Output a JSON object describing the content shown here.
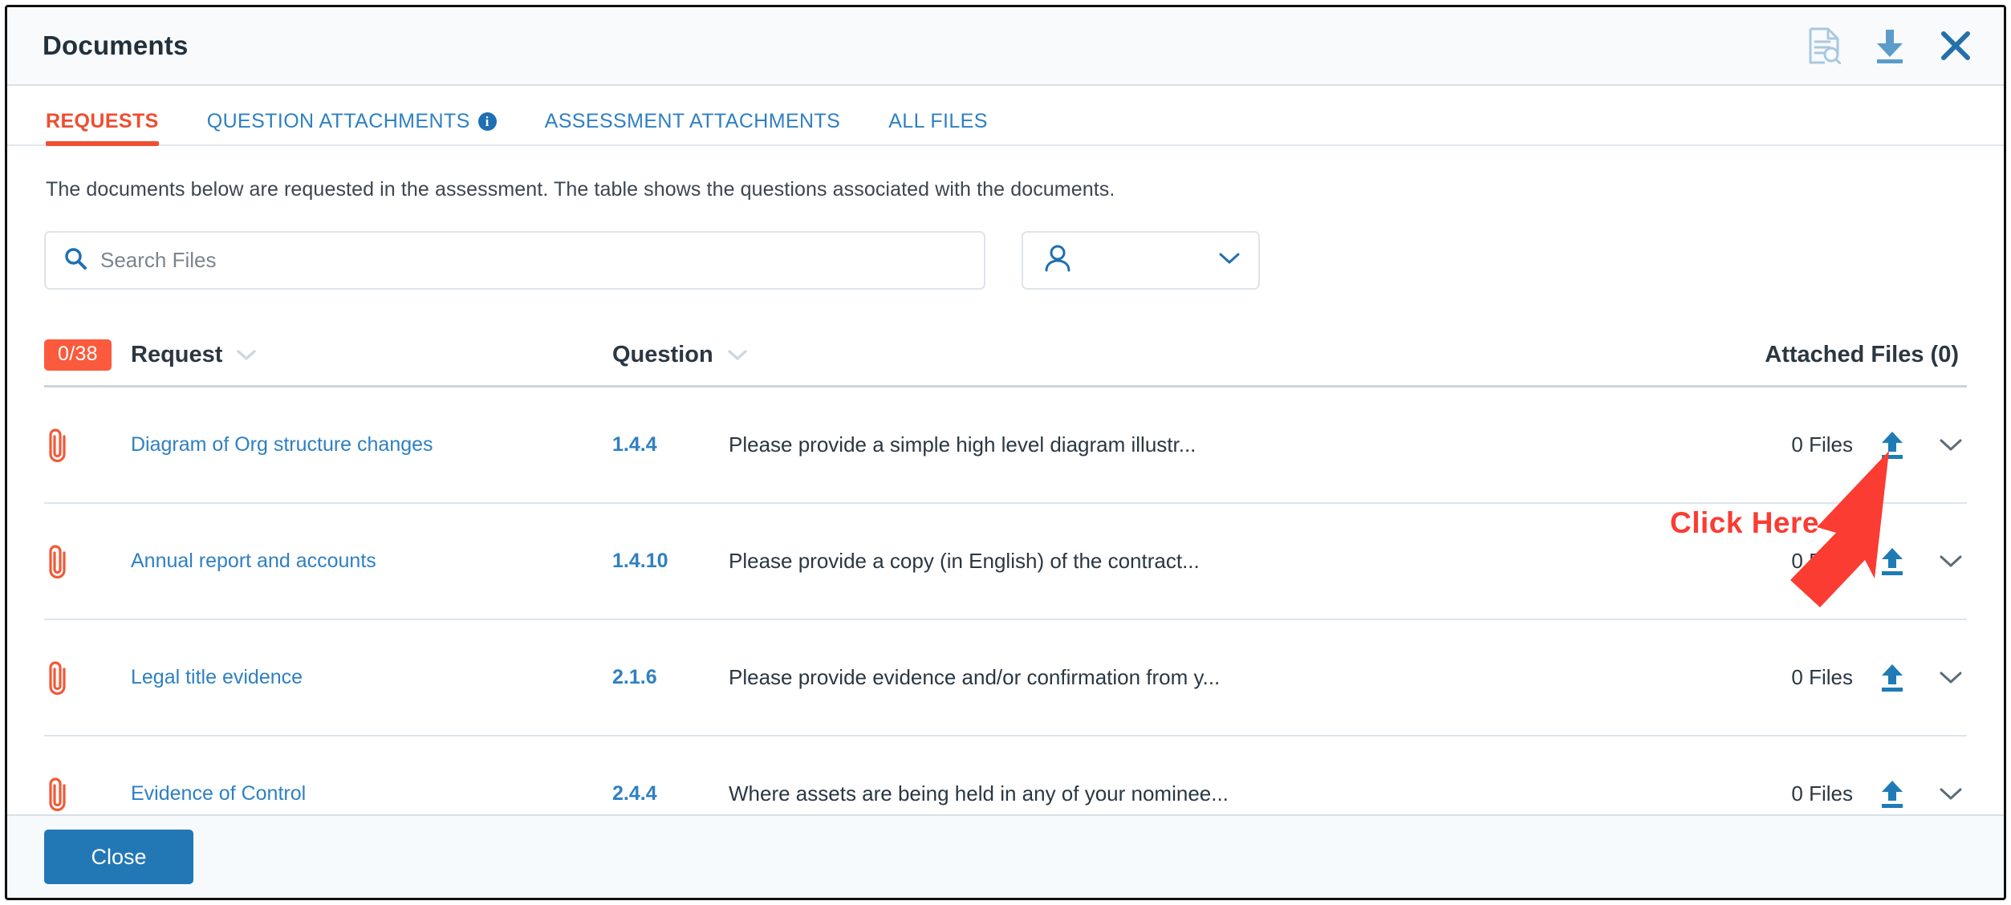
{
  "window": {
    "title": "Documents",
    "icons": [
      {
        "name": "document-search-icon"
      },
      {
        "name": "download-icon"
      },
      {
        "name": "close-icon"
      }
    ]
  },
  "tabs": [
    {
      "label": "REQUESTS",
      "active": true,
      "has_info": false
    },
    {
      "label": "QUESTION ATTACHMENTS",
      "active": false,
      "has_info": true,
      "info": "i"
    },
    {
      "label": "ASSESSMENT ATTACHMENTS",
      "active": false,
      "has_info": false
    },
    {
      "label": "ALL FILES",
      "active": false,
      "has_info": false
    }
  ],
  "description": "The documents below are requested in the assessment. The table shows the questions associated with the documents.",
  "search": {
    "placeholder": "Search Files",
    "value": ""
  },
  "person_filter": {
    "value": ""
  },
  "table": {
    "count_badge": "0/38",
    "headers": {
      "request": "Request",
      "question": "Question",
      "attached_files": "Attached Files (0)"
    },
    "rows": [
      {
        "request": "Diagram of Org structure changes",
        "question_number": "1.4.4",
        "question_text": "Please provide a simple high level diagram illustr...",
        "files": "0 Files"
      },
      {
        "request": "Annual report and accounts",
        "question_number": "1.4.10",
        "question_text": "Please provide a copy (in English) of the contract...",
        "files": "0 Files"
      },
      {
        "request": "Legal title evidence",
        "question_number": "2.1.6",
        "question_text": "Please provide evidence and/or confirmation from y...",
        "files": "0 Files"
      },
      {
        "request": "Evidence of Control",
        "question_number": "2.4.4",
        "question_text": "Where assets are being held in any of your nominee...",
        "files": "0 Files"
      }
    ]
  },
  "footer": {
    "close_label": "Close"
  },
  "annotation": {
    "label": "Click Here"
  },
  "colors": {
    "accent_orange": "#f04e30",
    "badge_orange": "#fb5a3c",
    "link_blue": "#2f80c2",
    "button_blue": "#2278b4",
    "annotation_red": "#fa3c32",
    "header_bg": "#f8fafc",
    "text_dark": "#2b3742"
  }
}
